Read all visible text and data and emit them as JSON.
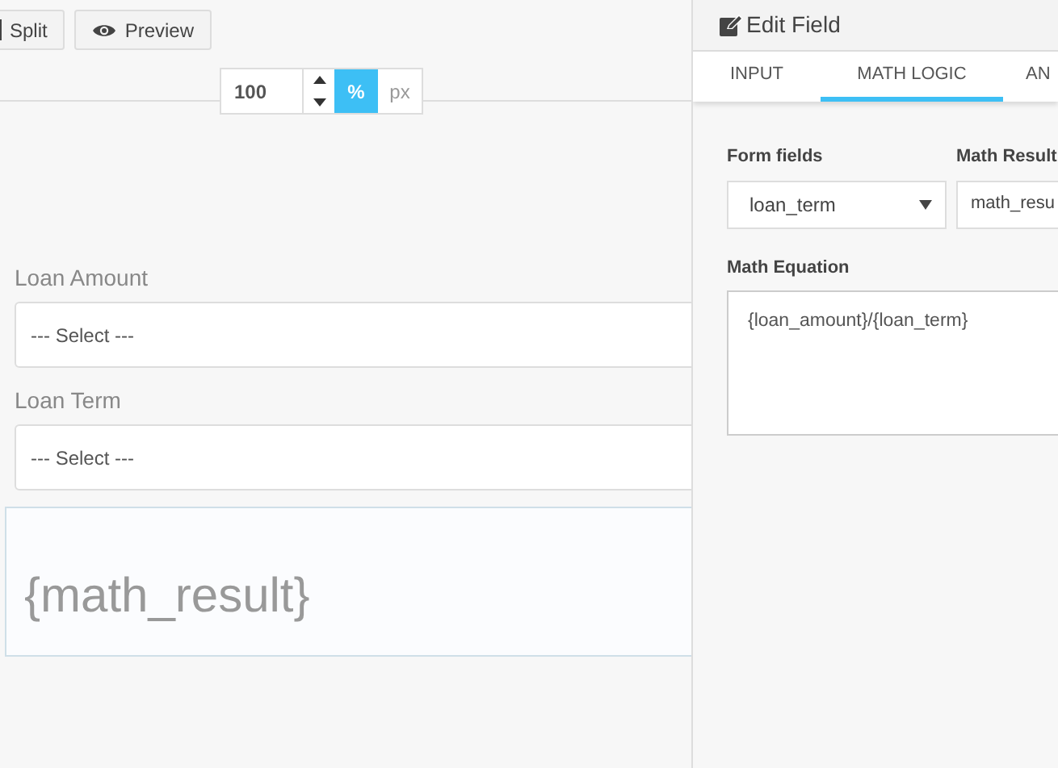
{
  "toolbar": {
    "buttons": [
      {
        "label": "Split",
        "kind": "split"
      },
      {
        "label": "Preview",
        "kind": "preview"
      }
    ]
  },
  "zoom": {
    "value": "100",
    "units": [
      {
        "label": "%",
        "selected": true
      },
      {
        "label": "px",
        "selected": false
      }
    ]
  },
  "form": {
    "fields": [
      {
        "label": "Loan Amount",
        "value": "--- Select ---"
      },
      {
        "label": "Loan Term",
        "value": "--- Select ---"
      }
    ],
    "result": "{math_result}"
  },
  "panel": {
    "title": "Edit Field",
    "tabs": [
      {
        "label": "INPUT",
        "selected": false
      },
      {
        "label": "MATH LOGIC",
        "selected": true
      },
      {
        "label": "AN",
        "selected": false
      }
    ],
    "form_fields": {
      "label": "Form fields",
      "value": "loan_term"
    },
    "math_result": {
      "label": "Math Result",
      "value": "math_resu"
    },
    "equation": {
      "label": "Math Equation",
      "value": "{loan_amount}/{loan_term}"
    }
  }
}
